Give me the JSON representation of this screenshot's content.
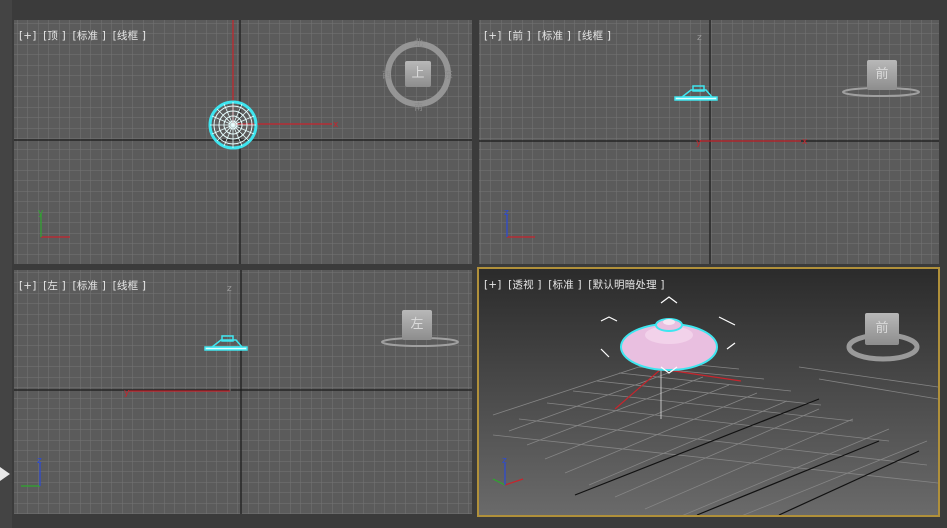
{
  "viewports": {
    "top": {
      "plus": "[+]",
      "view": "[顶 ]",
      "shading": "[标准 ]",
      "style": "[线框 ]",
      "cube_face": "上",
      "compass": {
        "north": "北",
        "south": "南",
        "east": "东",
        "west": "西"
      }
    },
    "front": {
      "plus": "[+]",
      "view": "[前 ]",
      "shading": "[标准 ]",
      "style": "[线框 ]",
      "cube_face": "前"
    },
    "left": {
      "plus": "[+]",
      "view": "[左 ]",
      "shading": "[标准 ]",
      "style": "[线框 ]",
      "cube_face": "左"
    },
    "perspective": {
      "plus": "[+]",
      "view": "[透视 ]",
      "shading": "[标准 ]",
      "style": "[默认明暗处理 ]",
      "cube_face": "前"
    }
  },
  "axis_labels": {
    "x": "x",
    "y": "y",
    "z": "z"
  },
  "colors": {
    "grid": "#6f6f6f",
    "grid_major": "#1c1c1c",
    "selection": "#3ee6f0",
    "axis_x": "#c8242c",
    "axis_y": "#2ea82e",
    "axis_z": "#2a4ad8",
    "active_border": "#b0903a",
    "object_fill": "#e9bfe0"
  }
}
